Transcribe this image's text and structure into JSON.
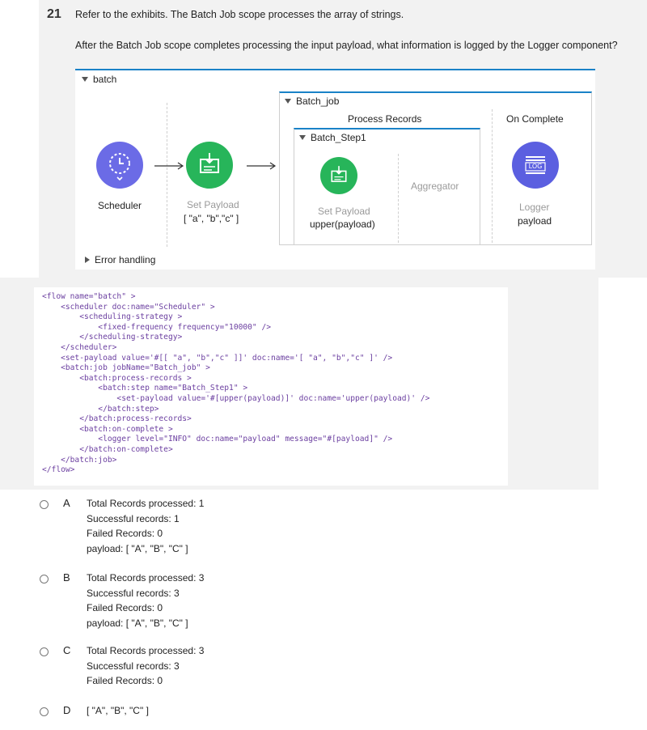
{
  "question": {
    "number": "21",
    "line1": "Refer to the exhibits. The Batch Job scope processes the array of strings.",
    "line2": "After the Batch Job scope completes processing the input payload, what information is logged by the Logger component?"
  },
  "diagram": {
    "flow_name": "batch",
    "scheduler_label": "Scheduler",
    "set_payload_label": "Set Payload",
    "set_payload_value": "[ \"a\", \"b\",\"c\" ]",
    "batch_job_label": "Batch_job",
    "process_records_label": "Process Records",
    "on_complete_label": "On Complete",
    "step_label": "Batch_Step1",
    "step_set_payload_label": "Set Payload",
    "step_set_payload_value": "upper(payload)",
    "aggregator_label": "Aggregator",
    "logger_label": "Logger",
    "logger_value": "payload",
    "logger_icon_text": "LOG",
    "error_handling_label": "Error handling",
    "colors": {
      "scheduler": "#6b6be6",
      "set_payload": "#27b55a",
      "logger": "#5b5fe0",
      "accent": "#1a82c7"
    }
  },
  "code": {
    "l01": "<flow name=\"batch\" >",
    "l02": "    <scheduler doc:name=\"Scheduler\" >",
    "l03": "        <scheduling-strategy >",
    "l04": "            <fixed-frequency frequency=\"10000\" />",
    "l05": "        </scheduling-strategy>",
    "l06": "    </scheduler>",
    "l07": "    <set-payload value='#[[ \"a\", \"b\",\"c\" ]]' doc:name='[ \"a\", \"b\",\"c\" ]' />",
    "l08": "    <batch:job jobName=\"Batch_job\" >",
    "l09": "        <batch:process-records >",
    "l10": "            <batch:step name=\"Batch_Step1\" >",
    "l11": "                <set-payload value='#[upper(payload)]' doc:name='upper(payload)' />",
    "l12": "            </batch:step>",
    "l13": "        </batch:process-records>",
    "l14": "        <batch:on-complete >",
    "l15": "            <logger level=\"INFO\" doc:name=\"payload\" message=\"#[payload]\" />",
    "l16": "        </batch:on-complete>",
    "l17": "    </batch:job>",
    "l18": "</flow>"
  },
  "options": [
    {
      "letter": "A",
      "lines": [
        "Total Records processed: 1",
        "Successful records: 1",
        "Failed Records: 0",
        "payload: [ \"A\", \"B\", \"C\" ]"
      ]
    },
    {
      "letter": "B",
      "lines": [
        "Total Records processed: 3",
        "Successful records: 3",
        "Failed Records: 0",
        "payload: [ \"A\", \"B\", \"C\" ]"
      ]
    },
    {
      "letter": "C",
      "lines": [
        "Total Records processed: 3",
        "Successful records: 3",
        "Failed Records: 0"
      ]
    },
    {
      "letter": "D",
      "lines": [
        "[ \"A\", \"B\", \"C\" ]"
      ]
    }
  ]
}
